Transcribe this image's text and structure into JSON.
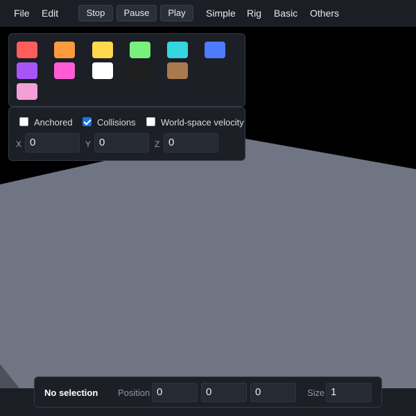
{
  "menubar": {
    "file": "File",
    "edit": "Edit",
    "stop": "Stop",
    "pause": "Pause",
    "play": "Play",
    "simple": "Simple",
    "rig": "Rig",
    "basic": "Basic",
    "others": "Others"
  },
  "palette": {
    "swatches": [
      "#ff5c5c",
      "#ff9a3c",
      "#ffd84d",
      "#78f07c",
      "#35d6e0",
      "#4f7bff",
      "#a855f7",
      "#ff5cd6",
      "#ffffff",
      "#1e1e1e",
      "#a97a4e",
      "#f2a0d6"
    ]
  },
  "properties": {
    "anchored": {
      "label": "Anchored",
      "checked": false
    },
    "collisions": {
      "label": "Collisions",
      "checked": true
    },
    "world_velocity": {
      "label": "World-space velocity",
      "checked": false
    },
    "x_label": "X",
    "x_value": "0",
    "y_label": "Y",
    "y_value": "0",
    "z_label": "Z",
    "z_value": "0"
  },
  "status": {
    "selection": "No selection",
    "position_label": "Position",
    "pos_x": "0",
    "pos_y": "0",
    "pos_z": "0",
    "size_label": "Size",
    "size_value": "1"
  },
  "colors": {
    "floor": "#6f7583",
    "accent": "#1a73e8"
  }
}
